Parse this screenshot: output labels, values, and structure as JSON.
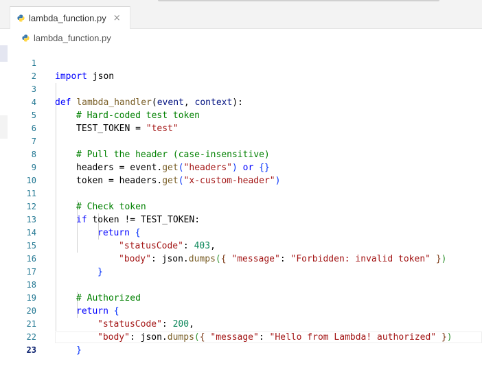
{
  "tab": {
    "label": "lambda_function.py",
    "close": "×"
  },
  "breadcrumb": {
    "file": "lambda_function.py"
  },
  "editor": {
    "line_numbers": [
      "1",
      "2",
      "3",
      "4",
      "5",
      "6",
      "7",
      "8",
      "9",
      "10",
      "11",
      "12",
      "13",
      "14",
      "15",
      "16",
      "17",
      "18",
      "19",
      "20",
      "21",
      "22",
      "23"
    ],
    "tokens": {
      "l1_kw": "import",
      "l1_mod": " json",
      "l3_kw": "def",
      "l3_fn": "lambda_handler",
      "l3_open": "(",
      "l3_p1": "event",
      "l3_sep": ", ",
      "l3_p2": "context",
      "l3_close": ")",
      "l3_colon": ":",
      "l4_com": "# Hard-coded test token",
      "l5_var": "TEST_TOKEN = ",
      "l5_str": "\"test\"",
      "l7_com": "# Pull the header (case-insensitive)",
      "l8_var": "headers = event.",
      "l8_fn": "get",
      "l8_open": "(",
      "l8_str": "\"headers\"",
      "l8_close": ")",
      "l8_or": " or ",
      "l8_braces": "{}",
      "l9_var": "token = headers.",
      "l9_fn": "get",
      "l9_open": "(",
      "l9_str": "\"x-custom-header\"",
      "l9_close": ")",
      "l11_com": "# Check token",
      "l12_kw": "if",
      "l12_rest": " token != TEST_TOKEN:",
      "l13_kw": "return",
      "l13_brace": " {",
      "l14_str": "\"statusCode\"",
      "l14_colon": ": ",
      "l14_num": "403",
      "l14_comma": ",",
      "l15_str": "\"body\"",
      "l15_mid": ": json.",
      "l15_fn": "dumps",
      "l15_open": "(",
      "l15_ob": "{ ",
      "l15_key": "\"message\"",
      "l15_colon": ": ",
      "l15_val": "\"Forbidden: invalid token\"",
      "l15_cb": " }",
      "l15_close": ")",
      "l16_brace": "}",
      "l18_com": "# Authorized",
      "l19_kw": "return",
      "l19_brace": " {",
      "l20_str": "\"statusCode\"",
      "l20_colon": ": ",
      "l20_num": "200",
      "l20_comma": ",",
      "l21_str": "\"body\"",
      "l21_mid": ": json.",
      "l21_fn": "dumps",
      "l21_open": "(",
      "l21_ob": "{ ",
      "l21_key": "\"message\"",
      "l21_colon": ": ",
      "l21_val": "\"Hello from Lambda! authorized\"",
      "l21_cb": " }",
      "l21_close": ")",
      "l22_brace": "}"
    }
  },
  "colors": {
    "keyword": "#0000ff",
    "function": "#795e26",
    "string": "#a31515",
    "comment": "#008000",
    "parameter": "#001080",
    "number": "#098658",
    "line_number": "#237893",
    "python_blue": "#3776ab",
    "python_yellow": "#ffd43b"
  },
  "icons": {
    "file_icon": "python-icon",
    "close_icon": "close-icon"
  }
}
